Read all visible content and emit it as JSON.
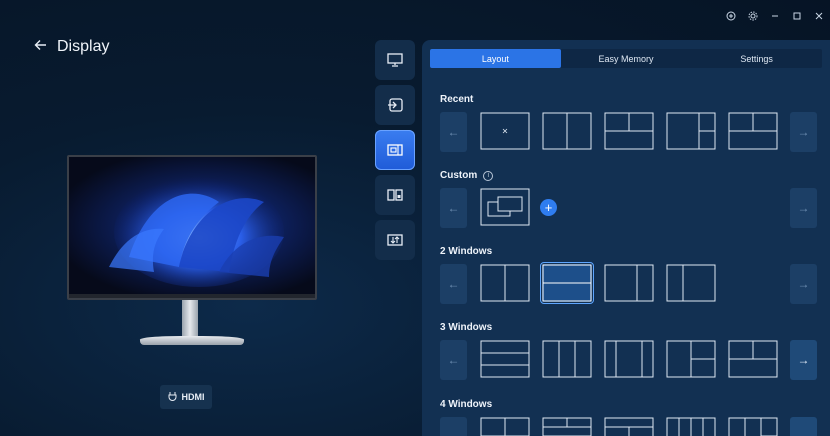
{
  "window": {
    "controls": [
      "plus-circle-icon",
      "gear-icon",
      "minimize-icon",
      "maximize-icon",
      "close-icon"
    ]
  },
  "header": {
    "title": "Display"
  },
  "monitor": {
    "input_label": "HDMI"
  },
  "strip": [
    "monitor-icon",
    "input-source-icon",
    "layout-icon",
    "picture-in-picture-icon",
    "display-settings-icon"
  ],
  "tabs": [
    {
      "label": "Layout",
      "active": true
    },
    {
      "label": "Easy Memory",
      "active": false
    },
    {
      "label": "Settings",
      "active": false
    }
  ],
  "sections": {
    "recent": "Recent",
    "custom": "Custom",
    "two": "2 Windows",
    "three": "3 Windows",
    "four": "4 Windows"
  },
  "colors": {
    "accent": "#2b74e6",
    "panel": "#123052",
    "background": "#081b30"
  }
}
